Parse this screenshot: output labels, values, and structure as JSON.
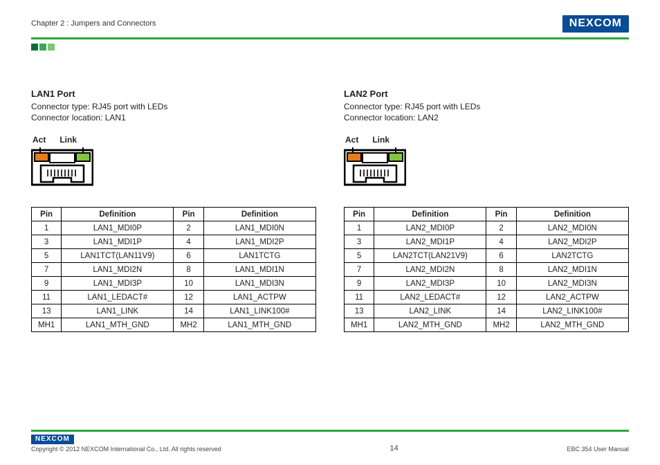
{
  "header": {
    "chapter": "Chapter 2 : Jumpers and Connectors",
    "brand": "NEXCOM"
  },
  "ports": [
    {
      "title": "LAN1 Port",
      "conn_type": "Connector type: RJ45 port with LEDs",
      "conn_loc": "Connector location: LAN1",
      "jack_labels": {
        "left": "Act",
        "right": "Link"
      },
      "table": {
        "headers": [
          "Pin",
          "Definition",
          "Pin",
          "Definition"
        ],
        "rows": [
          [
            "1",
            "LAN1_MDI0P",
            "2",
            "LAN1_MDI0N"
          ],
          [
            "3",
            "LAN1_MDI1P",
            "4",
            "LAN1_MDI2P"
          ],
          [
            "5",
            "LAN1TCT(LAN11V9)",
            "6",
            "LAN1TCTG"
          ],
          [
            "7",
            "LAN1_MDI2N",
            "8",
            "LAN1_MDI1N"
          ],
          [
            "9",
            "LAN1_MDI3P",
            "10",
            "LAN1_MDI3N"
          ],
          [
            "11",
            "LAN1_LEDACT#",
            "12",
            "LAN1_ACTPW"
          ],
          [
            "13",
            "LAN1_LINK",
            "14",
            "LAN1_LINK100#"
          ],
          [
            "MH1",
            "LAN1_MTH_GND",
            "MH2",
            "LAN1_MTH_GND"
          ]
        ]
      }
    },
    {
      "title": "LAN2 Port",
      "conn_type": "Connector type: RJ45 port with LEDs",
      "conn_loc": "Connector location: LAN2",
      "jack_labels": {
        "left": "Act",
        "right": "Link"
      },
      "table": {
        "headers": [
          "Pin",
          "Definition",
          "Pin",
          "Definition"
        ],
        "rows": [
          [
            "1",
            "LAN2_MDI0P",
            "2",
            "LAN2_MDI0N"
          ],
          [
            "3",
            "LAN2_MDI1P",
            "4",
            "LAN2_MDI2P"
          ],
          [
            "5",
            "LAN2TCT(LAN21V9)",
            "6",
            "LAN2TCTG"
          ],
          [
            "7",
            "LAN2_MDI2N",
            "8",
            "LAN2_MDI1N"
          ],
          [
            "9",
            "LAN2_MDI3P",
            "10",
            "LAN2_MDI3N"
          ],
          [
            "11",
            "LAN2_LEDACT#",
            "12",
            "LAN2_ACTPW"
          ],
          [
            "13",
            "LAN2_LINK",
            "14",
            "LAN2_LINK100#"
          ],
          [
            "MH1",
            "LAN2_MTH_GND",
            "MH2",
            "LAN2_MTH_GND"
          ]
        ]
      }
    }
  ],
  "footer": {
    "brand": "NEXCOM",
    "copyright": "Copyright © 2012 NEXCOM International Co., Ltd. All rights reserved",
    "page": "14",
    "manual": "EBC 354 User Manual"
  }
}
